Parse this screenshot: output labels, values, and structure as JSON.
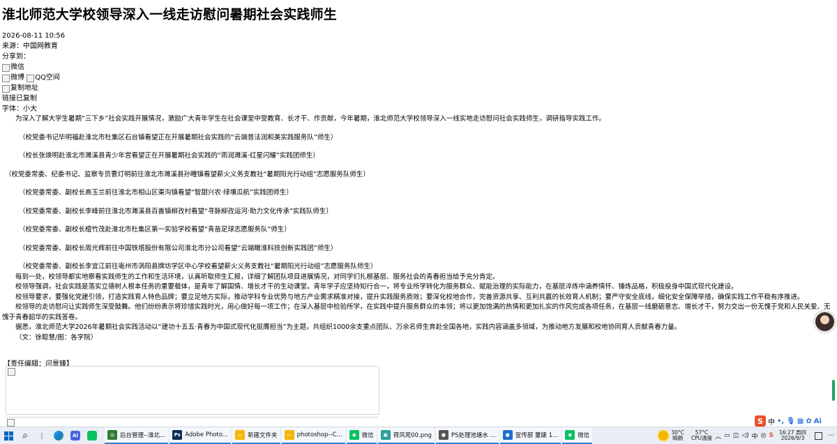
{
  "article": {
    "title": "淮北师范大学校领导深入一线走访慰问暑期社会实践师生",
    "datetime": "2026-08-11 10:56",
    "source": "来源：中国网教育",
    "share_label": "分享到：",
    "share_wechat": "微信",
    "share_weibo": "微博",
    "share_qzone": "QQ空间",
    "share_copy": "复制地址",
    "copied_notice": "链接已复制",
    "font_size_label": "字体：小大",
    "paragraphs": [
      {
        "kind": "text",
        "text": "为深入了解大学生暑期“三下乡”社会实践开展情况，激励广大青年学生在社会课堂中受教育、长才干、作贡献，今年暑期，淮北师范大学校领导深入一线实地走访慰问社会实践师生，调研指导实践工作。"
      },
      {
        "kind": "caption",
        "text": "（校党委书记毕明福赴淮北市杜集区石台镇看望正在开展暑期社会实践的“云端普法润和美实践服务队”师生）"
      },
      {
        "kind": "caption",
        "text": "（校长张焕明赴淮北市濉溪县青少年宫看望正在开展暑期社会实践的“雨润濉溪·红星闪耀”实践团师生）"
      },
      {
        "kind": "caption2",
        "text": "（校党委常委、纪委书记、监察专员曹灯明前往淮北市濉溪县孙疃镇看望薪火义务支教社“暑期阳光行动组”志愿服务队师生）"
      },
      {
        "kind": "caption",
        "text": "（校党委常委、副校长高玉兰前往淮北市相山区渠沟镇看望“智甜兴农·绿壤瓜航”实践团师生）"
      },
      {
        "kind": "caption",
        "text": "（校党委常委、副校长李峰前往淮北市濉溪县百善镇柳孜村看望“寻脉柳孜运河·助力文化传承”实践队师生）"
      },
      {
        "kind": "caption",
        "text": "（校党委常委、副校长檀竹茂赴淮北市杜集区第一实验学校看望“青苗足球志愿服务队”师生）"
      },
      {
        "kind": "caption",
        "text": "（校党委常委、副校长周光辉前往中国铁塔股份有限公司淮北市分公司看望“云端瞰淮科技创新实践团”师生）"
      },
      {
        "kind": "caption",
        "text": "（校党委常委、副校长李宜江前往亳州市涡阳县牌坊学区中心学校看望薪火义务支教社“暑期阳光行动组”志愿服务队师生）",
        "tight": true
      },
      {
        "kind": "text",
        "text": "每到一处，校领导都实地察看实践师生的工作和生活环境，认真听取师生汇报，详细了解团队项目进展情况，对同学们扎根基层、服务社会的青春担当给予充分肯定。"
      },
      {
        "kind": "text",
        "text": "校领导强调，社会实践是落实立德树人根本任务的重要载体，是青年了解国情、增长才干的生动课堂。青年学子应坚持知行合一，将专业所学转化为服务群众、赋能治理的实际能力，在基层淬炼中涵养情怀、锤炼品格，积极投身中国式现代化建设。"
      },
      {
        "kind": "text",
        "wrap": true,
        "text": "校领导要求，要强化党建引领，打造实践育人特色品牌；要立足地方实际，推动学科专业优势与地方产业需求精准对接，提升实践服务质效；要深化校地合作，完善资源共享、互利共赢的长效育人机制；要严守安全底线，细化安全保障举措，确保实践工作平稳有序推进。"
      },
      {
        "kind": "text",
        "wrap": true,
        "text": "校领导的走访慰问让实践师生深受鼓舞。他们纷纷表示将珍惜实践时光，用心做好每一项工作；在深入基层中检验所学，在实践中提升服务群众的本领；将以更加饱满的热情和更加扎实的作风完成各项任务，在基层一线磨砺意志、增长才干，努力交出一份无愧于党和人民关爱、无愧于青春韶华的实践答卷。"
      },
      {
        "kind": "text",
        "text": "据悉，淮北师范大学2026年暑期社会实践活动以“建功十五五·青春为中国式现代化挺膺担当”为主题，共组织1000余支重点团队、万余名师生奔赴全国各地，实践内容涵盖多领域，为推动地方发展和校地协同育人贡献青春力量。"
      },
      {
        "kind": "text",
        "text": "（文：徐聪慧/图：各学院）"
      }
    ],
    "editor": "【责任编辑：闫景臻】"
  },
  "ime": {
    "lang": "中",
    "extra": "Ai"
  },
  "taskbar": {
    "tasks": [
      {
        "label": "后台管理--淮北...",
        "color": "#2f7d32",
        "glyph": "◎"
      },
      {
        "label": "Adobe Photo...",
        "color": "#0a2a57",
        "glyph": "Ps"
      },
      {
        "label": "新建文件夹",
        "color": "#f2b705",
        "glyph": "▭"
      },
      {
        "label": "photoshop--C...",
        "color": "#f2b705",
        "glyph": "▭"
      },
      {
        "label": "微信",
        "color": "#07c160",
        "glyph": "◉"
      },
      {
        "label": "荷风苑00.png",
        "color": "#2aa198",
        "glyph": "▣"
      },
      {
        "label": "PS处理池塘水 ...",
        "color": "#555555",
        "glyph": "●"
      },
      {
        "label": "宣传部 董婕 1...",
        "color": "#1d6fd1",
        "glyph": "●"
      },
      {
        "label": "微信",
        "color": "#07c160",
        "glyph": "◉"
      }
    ],
    "weather_temp": "30°C",
    "weather_desc": "晴朗",
    "cpu_temp": "57°C",
    "cpu_label": "CPU温度",
    "clock_time": "16:27 周四",
    "clock_date": "2026/9/3"
  }
}
